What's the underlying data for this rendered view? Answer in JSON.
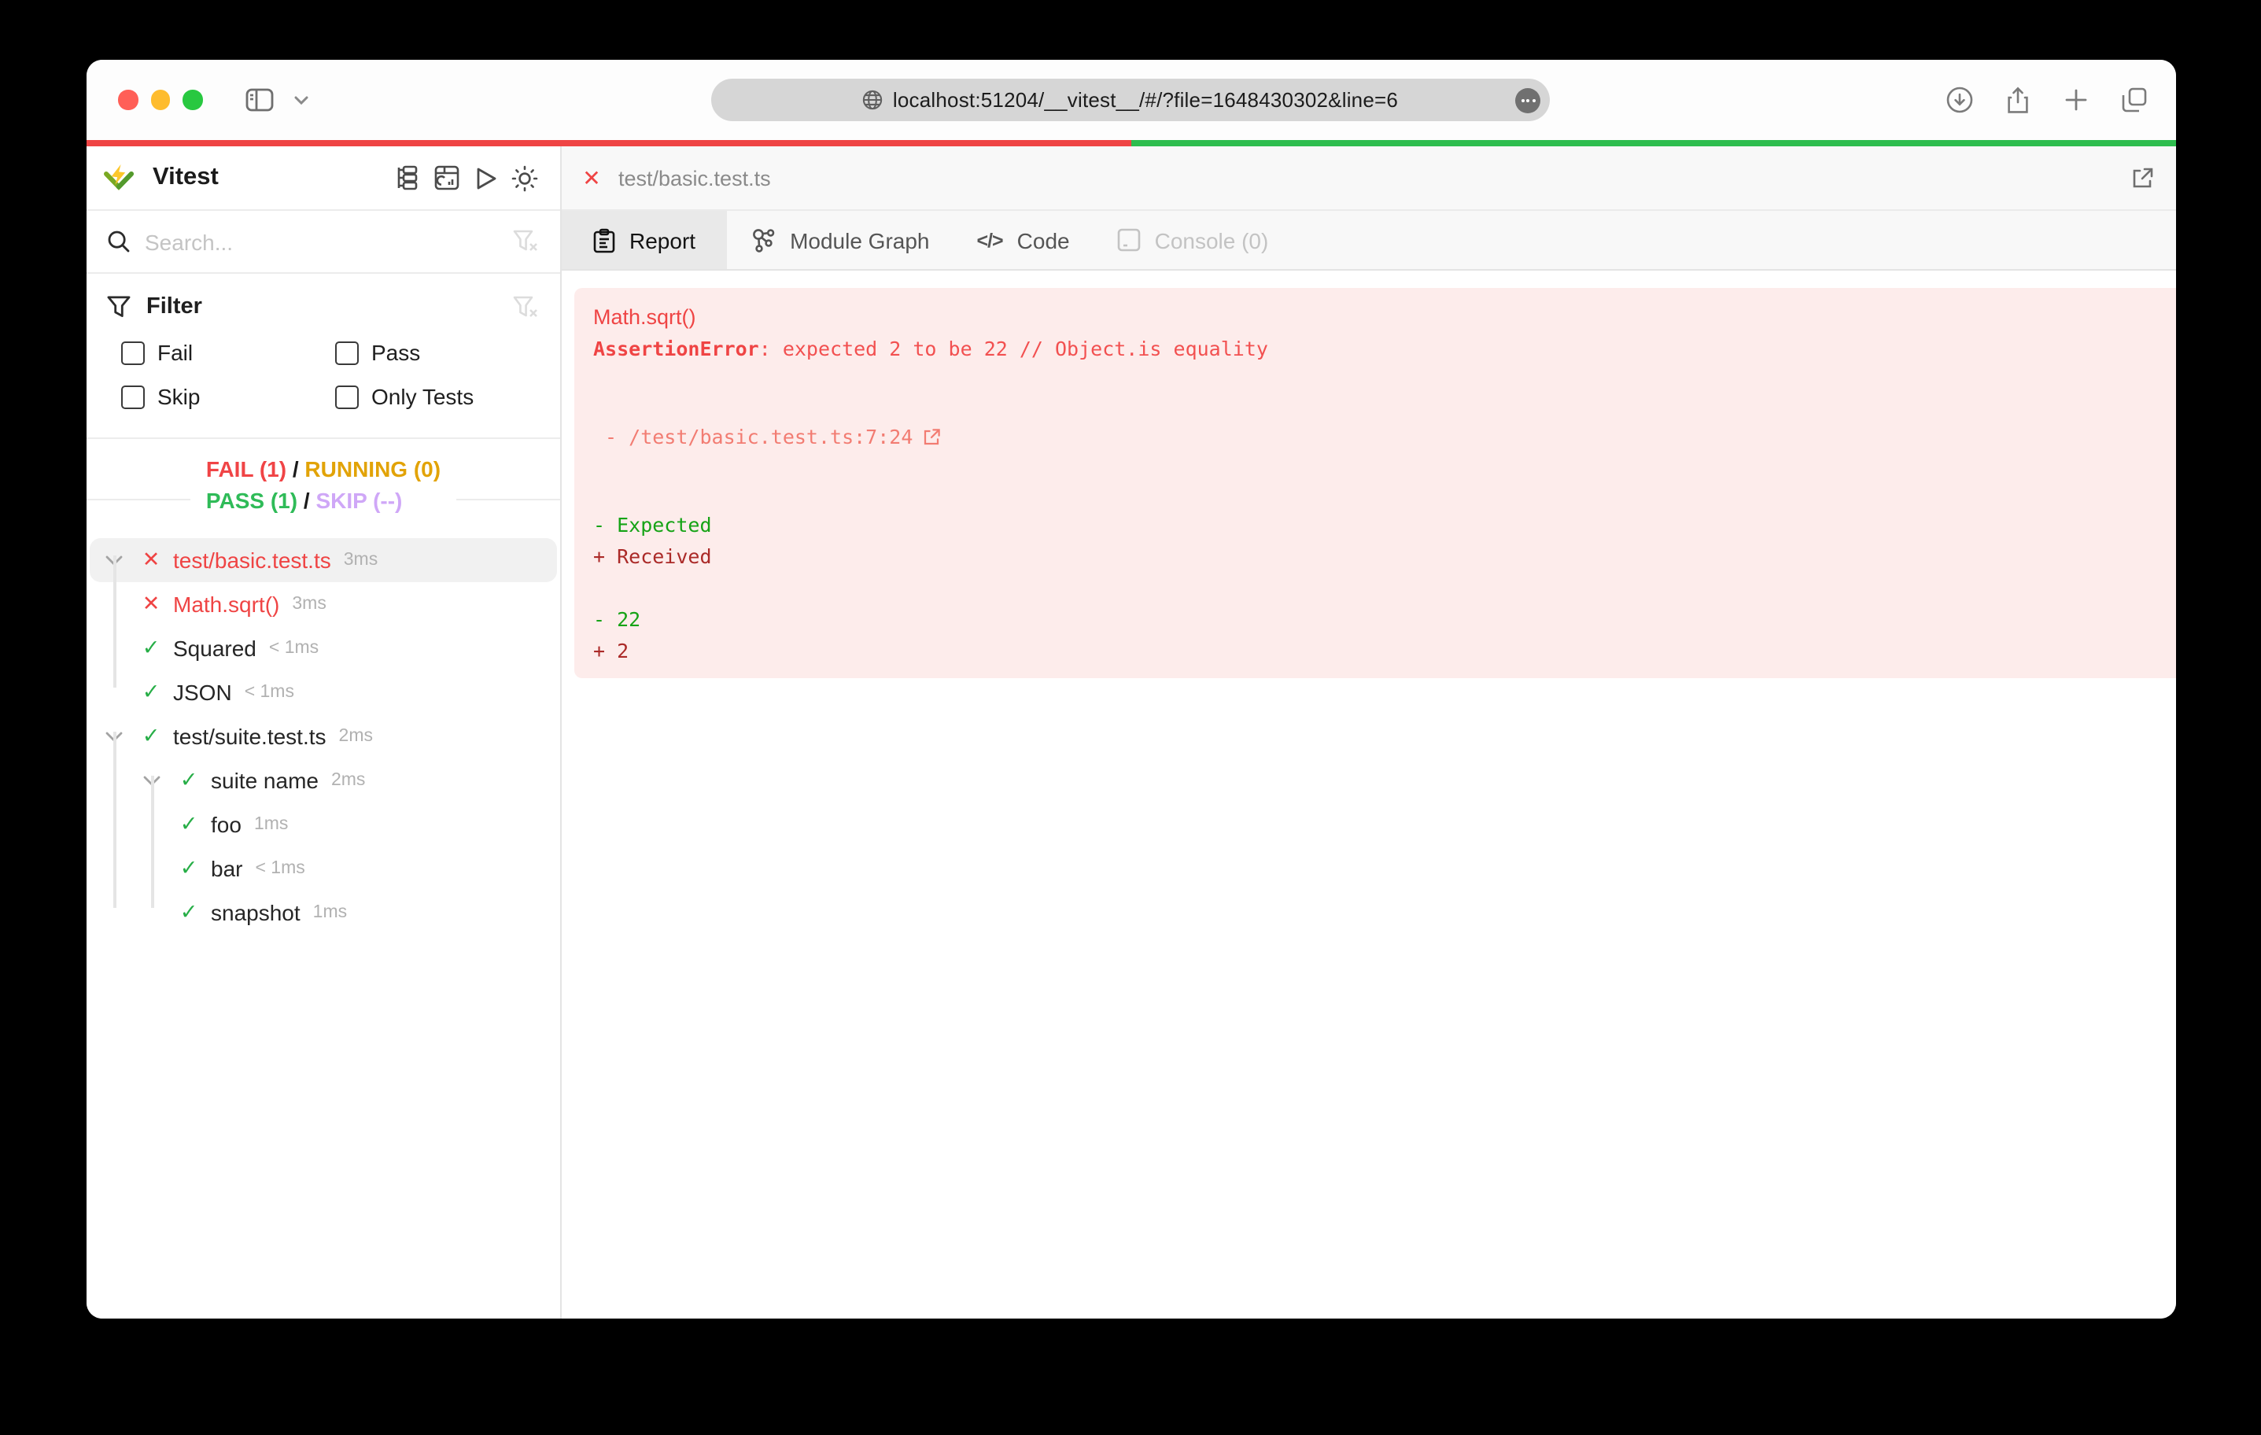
{
  "browser": {
    "url": "localhost:51204/__vitest__/#/?file=1648430302&line=6"
  },
  "app": {
    "title": "Vitest"
  },
  "search": {
    "placeholder": "Search..."
  },
  "filter": {
    "title": "Filter",
    "options": [
      {
        "label": "Fail"
      },
      {
        "label": "Pass"
      },
      {
        "label": "Skip"
      },
      {
        "label": "Only Tests"
      }
    ]
  },
  "summary": {
    "fail": "FAIL (1)",
    "sep1": "/",
    "running": "RUNNING (0)",
    "pass": "PASS (1)",
    "sep2": "/",
    "skip": "SKIP (--)"
  },
  "tree": [
    {
      "label": "test/basic.test.ts",
      "time": "3ms",
      "status": "fail"
    },
    {
      "label": "Math.sqrt()",
      "time": "3ms",
      "status": "fail"
    },
    {
      "label": "Squared",
      "time": "< 1ms",
      "status": "pass"
    },
    {
      "label": "JSON",
      "time": "< 1ms",
      "status": "pass"
    },
    {
      "label": "test/suite.test.ts",
      "time": "2ms",
      "status": "pass"
    },
    {
      "label": "suite name",
      "time": "2ms",
      "status": "pass"
    },
    {
      "label": "foo",
      "time": "1ms",
      "status": "pass"
    },
    {
      "label": "bar",
      "time": "< 1ms",
      "status": "pass"
    },
    {
      "label": "snapshot",
      "time": "1ms",
      "status": "pass"
    }
  ],
  "main": {
    "file": "test/basic.test.ts",
    "tabs": [
      {
        "label": "Report"
      },
      {
        "label": "Module Graph"
      },
      {
        "label": "Code"
      },
      {
        "label": "Console (0)"
      }
    ]
  },
  "report": {
    "test_name": "Math.sqrt()",
    "error_name": "AssertionError",
    "error_rest": ": expected 2 to be 22 // Object.is equality",
    "location": " - /test/basic.test.ts:7:24",
    "diff_expected_label": "- Expected",
    "diff_received_label": "+ Received",
    "diff_expected_value": "- 22",
    "diff_received_value": "+ 2"
  },
  "icons": {
    "cross": "✕",
    "check": "✓",
    "plus": "+",
    "code_glyph": "</>"
  },
  "colors": {
    "fail": "#ef4444",
    "pass": "#2fbb58",
    "running": "#e2a307",
    "skip": "#cfa7f7",
    "progress_red": "#ef4444",
    "progress_green": "#2ebd4e",
    "error_panel_bg": "#fdeceb",
    "diff_green": "#16a316",
    "diff_dark_red": "#ab2a28"
  }
}
